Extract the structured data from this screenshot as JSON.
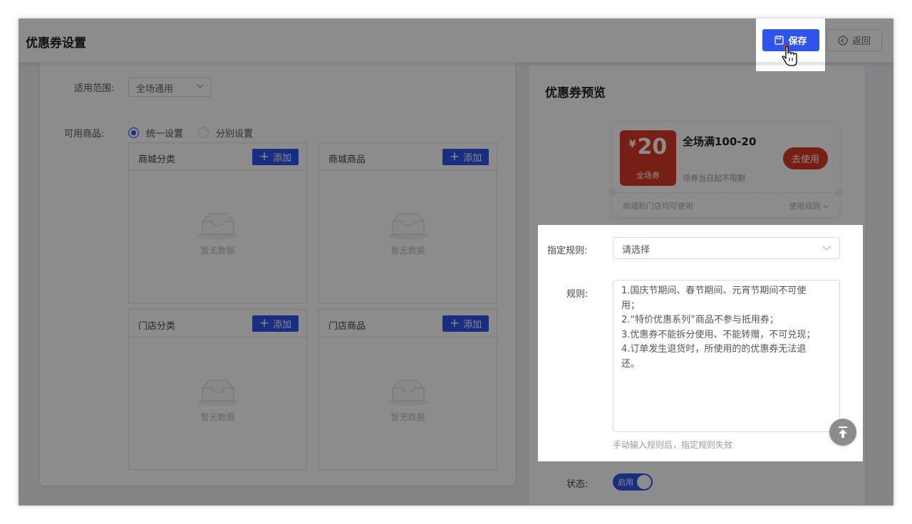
{
  "header": {
    "title": "优惠券设置",
    "save_label": "保存",
    "back_label": "返回"
  },
  "form": {
    "scope_label": "适用范围:",
    "scope_value": "全场通用",
    "goods_label": "可用商品:",
    "radio_options": [
      {
        "label": "统一设置",
        "checked": true
      },
      {
        "label": "分别设置",
        "checked": false
      }
    ],
    "add_label": "添加",
    "empty_text": "暂无数据",
    "panels": [
      {
        "title": "商城分类"
      },
      {
        "title": "商城商品"
      },
      {
        "title": "门店分类"
      },
      {
        "title": "门店商品"
      }
    ]
  },
  "preview": {
    "title": "优惠券预览",
    "coupon": {
      "currency": "¥",
      "amount": "20",
      "type": "全场券",
      "name": "全场满100-20",
      "validity": "领券当日起不限期",
      "use_label": "去使用",
      "note": "商城和门店均可使用",
      "rules_link": "使用规则"
    },
    "rule_label": "指定规则:",
    "rule_placeholder": "请选择",
    "rules_label": "规则:",
    "rules_text": "1.国庆节期间、春节期间、元宵节期间不可使\n用；\n2.“特价优惠系列”商品不参与抵用券；\n3.优惠券不能拆分使用、不能转赠，不可兑现；\n4.订单发生退货时，所使用的的优惠券无法退\n还。",
    "rules_hint": "手动输入规则后，指定规则失效",
    "status_label": "状态:",
    "status_toggle": "启用",
    "status_on": true
  },
  "colors": {
    "primary": "#2f54eb",
    "coupon_red": "#d93a26"
  }
}
